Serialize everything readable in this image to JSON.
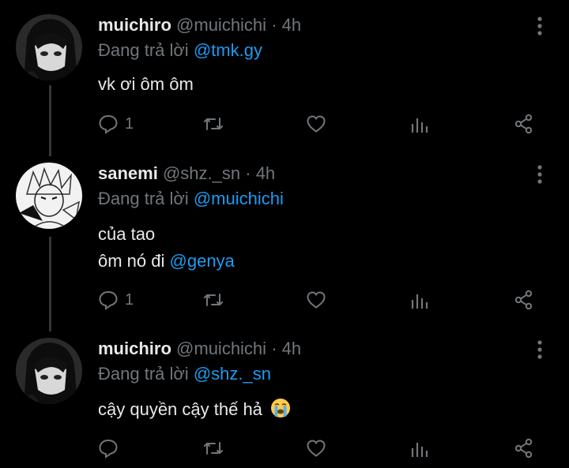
{
  "tweets": [
    {
      "name": "muichiro",
      "handle": "@muichichi",
      "dot": "·",
      "time": "4h",
      "replying_prefix": "Đang trả lời",
      "replying_to": "@tmk.gy",
      "body_lines": [
        "vk ơi ôm ôm"
      ],
      "reply_count": "1"
    },
    {
      "name": "sanemi",
      "handle": "@shz._sn",
      "dot": "·",
      "time": "4h",
      "replying_prefix": "Đang trả lời",
      "replying_to": "@muichichi",
      "body_line1": "của tao",
      "body_line2_text": "ôm nó đi",
      "body_line2_mention": "@genya",
      "reply_count": "1"
    },
    {
      "name": "muichiro",
      "handle": "@muichichi",
      "dot": "·",
      "time": "4h",
      "replying_prefix": "Đang trả lời",
      "replying_to": "@shz._sn",
      "body_text": "cậy quyền cậy thế hả",
      "body_emoji": "loudly-crying-face-emoji",
      "reply_count": ""
    }
  ],
  "colors": {
    "background": "#000000",
    "text": "#e7e9ea",
    "secondary": "#71767b",
    "mention": "#1d9bf0"
  },
  "icons": [
    "more-vertical-icon",
    "reply-icon",
    "retweet-icon",
    "like-icon",
    "views-icon",
    "share-icon"
  ]
}
